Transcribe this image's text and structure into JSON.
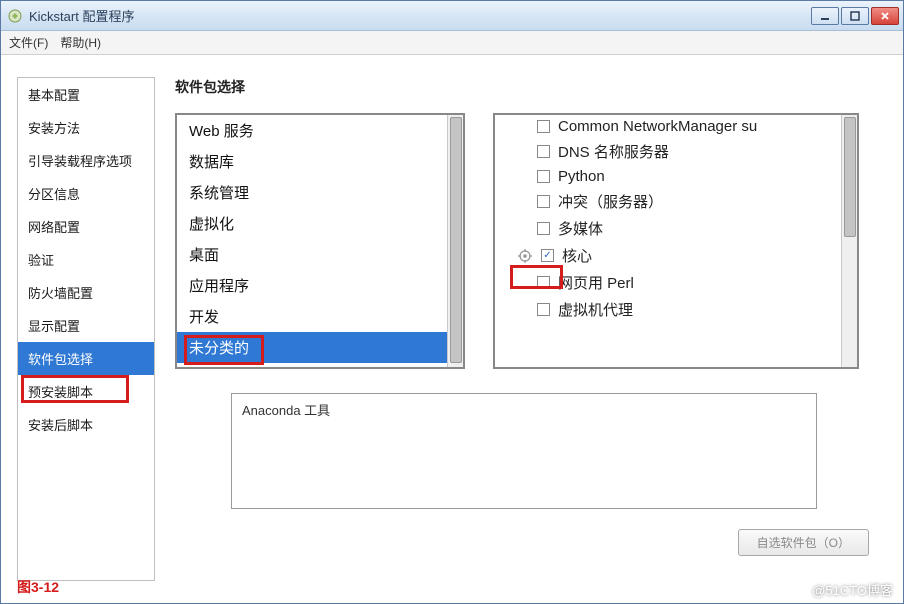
{
  "window": {
    "title": "Kickstart 配置程序"
  },
  "menubar": {
    "file": "文件(F)",
    "help": "帮助(H)"
  },
  "sidebar": {
    "items": [
      {
        "label": "基本配置"
      },
      {
        "label": "安装方法"
      },
      {
        "label": "引导装载程序选项"
      },
      {
        "label": "分区信息"
      },
      {
        "label": "网络配置"
      },
      {
        "label": "验证"
      },
      {
        "label": "防火墙配置"
      },
      {
        "label": "显示配置"
      },
      {
        "label": "软件包选择"
      },
      {
        "label": "预安装脚本"
      },
      {
        "label": "安装后脚本"
      }
    ],
    "selected_index": 8
  },
  "main": {
    "heading": "软件包选择",
    "categories": [
      {
        "label": "Web 服务"
      },
      {
        "label": "数据库"
      },
      {
        "label": "系统管理"
      },
      {
        "label": "虚拟化"
      },
      {
        "label": "桌面"
      },
      {
        "label": "应用程序"
      },
      {
        "label": "开发"
      },
      {
        "label": "未分类的"
      }
    ],
    "category_selected_index": 7,
    "packages": [
      {
        "label": "Common NetworkManager su",
        "checked": false,
        "core": false
      },
      {
        "label": "DNS 名称服务器",
        "checked": false,
        "core": false
      },
      {
        "label": "Python",
        "checked": false,
        "core": false
      },
      {
        "label": "冲突（服务器）",
        "checked": false,
        "core": false
      },
      {
        "label": "多媒体",
        "checked": false,
        "core": false
      },
      {
        "label": "核心",
        "checked": true,
        "core": true
      },
      {
        "label": "网页用  Perl",
        "checked": false,
        "core": false
      },
      {
        "label": "虚拟机代理",
        "checked": false,
        "core": false
      }
    ],
    "description": "Anaconda 工具",
    "optional_button": "自选软件包（O）"
  },
  "figure_label": "图3-12",
  "watermark": "@51CTO博客"
}
